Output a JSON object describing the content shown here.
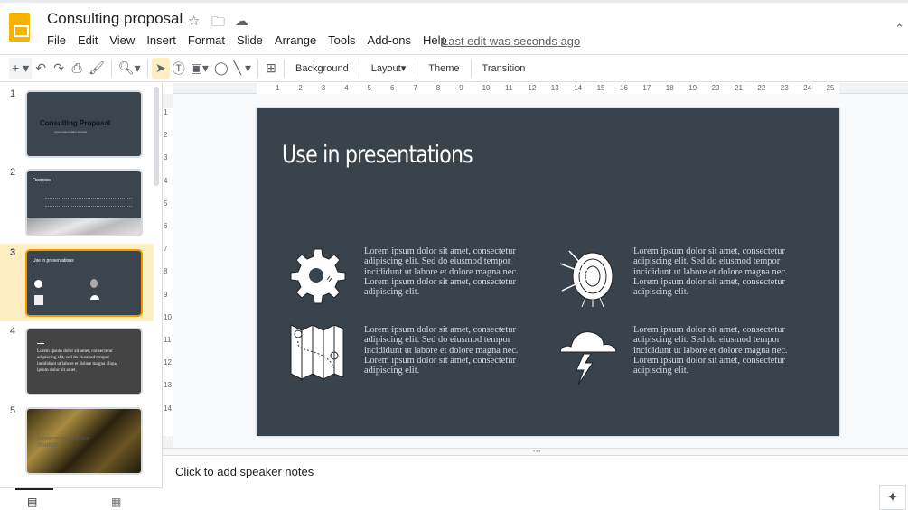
{
  "app": {
    "title": "Consulting proposal",
    "last_edit": "Last edit was seconds ago",
    "menu": [
      "File",
      "Edit",
      "View",
      "Insert",
      "Format",
      "Slide",
      "Arrange",
      "Tools",
      "Add-ons",
      "Help"
    ]
  },
  "toolbar": {
    "background": "Background",
    "layout": "Layout",
    "theme": "Theme",
    "transition": "Transition"
  },
  "ruler": {
    "h": [
      "1",
      "2",
      "3",
      "4",
      "5",
      "6",
      "7",
      "8",
      "9",
      "10",
      "11",
      "12",
      "13",
      "14",
      "15",
      "16",
      "17",
      "18",
      "19",
      "20",
      "21",
      "22",
      "23",
      "24",
      "25"
    ],
    "v": [
      "1",
      "2",
      "3",
      "4",
      "5",
      "6",
      "7",
      "8",
      "9",
      "10",
      "11",
      "12",
      "13",
      "14"
    ]
  },
  "filmstrip": {
    "slides": [
      {
        "num": "1",
        "title": "Consulting Proposal",
        "sub": "Lorem ipsum dolor sit amet"
      },
      {
        "num": "2",
        "title": "Overview"
      },
      {
        "num": "3",
        "title": "Use in presentations"
      },
      {
        "num": "4",
        "text": "Lorem ipsum dolor sit amet, consectetur adipiscing elit, sed do eiusmod tempor incididunt ut labore et dolore magna aliqua ipsum dolor sit amet."
      },
      {
        "num": "5",
        "title": "Understanding the market"
      }
    ],
    "selected": 3
  },
  "slide": {
    "title": "Use in presentations",
    "blocks": [
      {
        "icon": "gear-icon",
        "text": "Lorem ipsum dolor sit amet, consectetur adipiscing elit. Sed do eiusmod tempor incididunt ut labore et dolore magna nec. Lorem ipsum dolor sit amet, consectetur adipiscing elit."
      },
      {
        "icon": "target-icon",
        "text": "Lorem ipsum dolor sit amet, consectetur adipiscing elit. Sed do eiusmod tempor incididunt ut labore et dolore magna nec. Lorem ipsum dolor sit amet, consectetur adipiscing elit."
      },
      {
        "icon": "map-icon",
        "text": "Lorem ipsum dolor sit amet, consectetur adipiscing elit. Sed do eiusmod tempor incididunt ut labore et dolore magna nec. Lorem ipsum dolor sit amet, consectetur adipiscing elit."
      },
      {
        "icon": "storm-cloud-icon",
        "text": "Lorem ipsum dolor sit amet, consectetur adipiscing elit. Sed do eiusmod tempor incididunt ut labore et dolore magna nec. Lorem ipsum dolor sit amet, consectetur adipiscing elit."
      }
    ]
  },
  "notes": {
    "placeholder": "Click to add speaker notes"
  },
  "colors": {
    "slide_bg": "#38434b",
    "accent": "#f29900",
    "selected_bg": "#feefc3"
  }
}
